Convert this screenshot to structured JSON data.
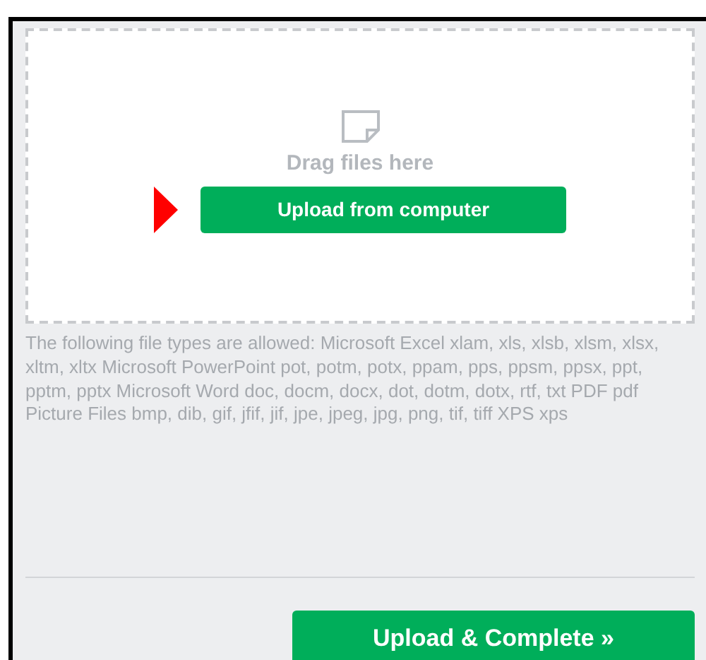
{
  "dropzone": {
    "hint": "Drag files here",
    "button": "Upload from computer"
  },
  "allowed_types": "The following file types are allowed: Microsoft Excel xlam, xls, xlsb, xlsm, xlsx, xltm, xltx Microsoft PowerPoint pot, potm, potx, ppam, pps, ppsm, ppsx, ppt, pptm, pptx Microsoft Word doc, docm, docx, dot, dotm, dotx, rtf, txt PDF pdf Picture Files bmp, dib, gif, jfif, jif, jpe, jpeg, jpg, png, tif, tiff XPS xps",
  "footer": {
    "button": "Upload & Complete »"
  }
}
